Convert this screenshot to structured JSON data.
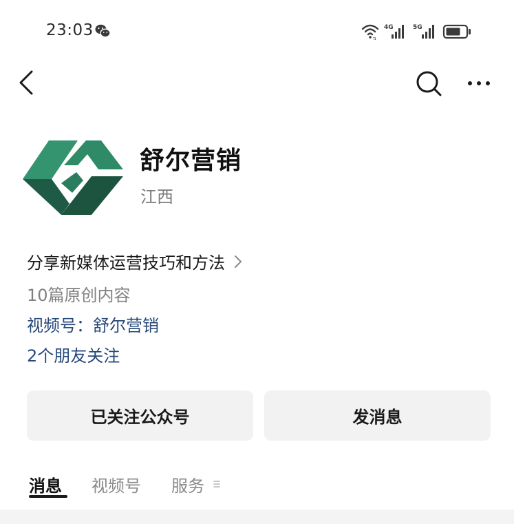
{
  "status_bar": {
    "time": "23:03",
    "wechat_icon": "wechat-icon",
    "wifi_icon": "wifi-icon",
    "network_1": "4G",
    "network_2": "5G",
    "battery_icon": "battery-icon"
  },
  "nav": {
    "back_icon": "chevron-left-icon",
    "search_icon": "search-icon",
    "more_icon": "more-icon"
  },
  "account": {
    "name": "舒尔营销",
    "region": "江西",
    "logo_colors": [
      "#2e8a6a",
      "#1e5a45"
    ]
  },
  "info": {
    "intro": "分享新媒体运营技巧和方法",
    "original_count": "10篇原创内容",
    "channels": "视频号：舒尔营销",
    "friends": "2个朋友关注"
  },
  "buttons": {
    "followed": "已关注公众号",
    "message": "发消息"
  },
  "tabs": [
    {
      "label": "消息",
      "active": true
    },
    {
      "label": "视频号",
      "active": false
    },
    {
      "label": "服务",
      "active": false
    }
  ],
  "colors": {
    "link": "#27497a",
    "button_bg": "#f2f2f2",
    "muted": "#808080"
  }
}
